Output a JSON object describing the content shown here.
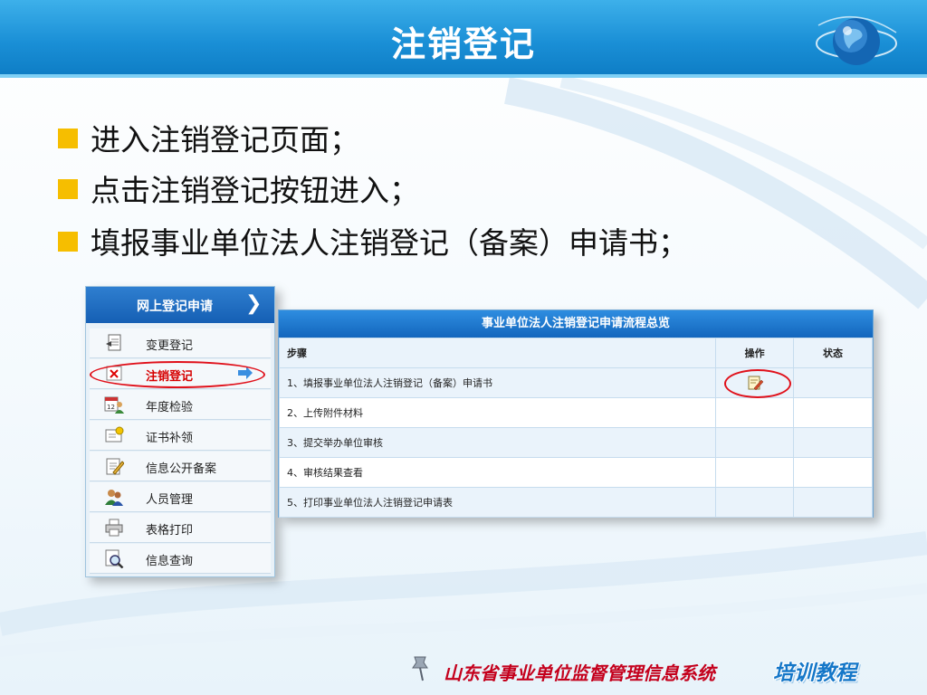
{
  "title": "注销登记",
  "bullets": [
    "进入注销登记页面；",
    "点击注销登记按钮进入；",
    "填报事业单位法人注销登记（备案）申请书；"
  ],
  "nav": {
    "header": "网上登记申请",
    "items": [
      {
        "label": "变更登记",
        "icon": "document-edit-icon"
      },
      {
        "label": "注销登记",
        "icon": "cancel-document-icon",
        "active": true
      },
      {
        "label": "年度检验",
        "icon": "calendar-user-icon"
      },
      {
        "label": "证书补领",
        "icon": "certificate-icon"
      },
      {
        "label": "信息公开备案",
        "icon": "notepad-pencil-icon"
      },
      {
        "label": "人员管理",
        "icon": "users-icon"
      },
      {
        "label": "表格打印",
        "icon": "printer-icon"
      },
      {
        "label": "信息查询",
        "icon": "magnifier-document-icon"
      }
    ]
  },
  "flow": {
    "title": "事业单位法人注销登记申请流程总览",
    "columns": [
      "步骤",
      "操作",
      "状态"
    ],
    "rows": [
      {
        "step": "1、填报事业单位法人注销登记（备案）申请书",
        "has_action": true,
        "status": ""
      },
      {
        "step": "2、上传附件材料",
        "has_action": false,
        "status": ""
      },
      {
        "step": "3、提交举办单位审核",
        "has_action": false,
        "status": ""
      },
      {
        "step": "4、审核结果查看",
        "has_action": false,
        "status": ""
      },
      {
        "step": "5、打印事业单位法人注销登记申请表",
        "has_action": false,
        "status": ""
      }
    ]
  },
  "footer": {
    "org": "山东省事业单位监督管理信息系统",
    "tag": "培训教程"
  },
  "colors": {
    "accent": "#1a8fd6",
    "bullet": "#f6be00",
    "highlight": "#e0101a",
    "active_text": "#d60000"
  }
}
